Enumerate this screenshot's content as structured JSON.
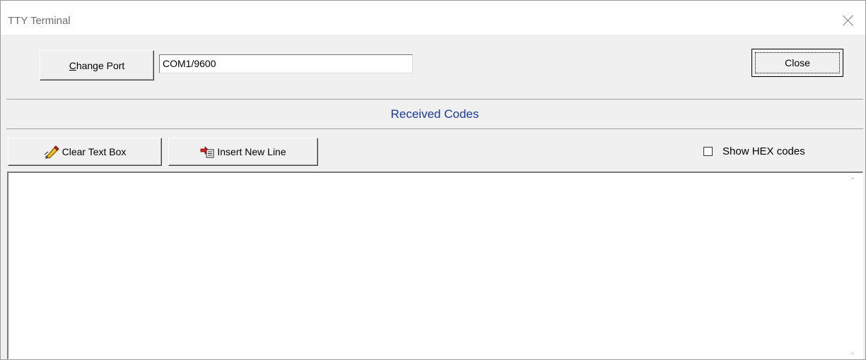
{
  "window": {
    "title": "TTY Terminal"
  },
  "port": {
    "change_port_label_rest": "hange Port",
    "change_port_accel": "C",
    "value": "COM1/9600"
  },
  "close_label": "Close",
  "section_title": "Received Codes",
  "toolbar": {
    "clear_label": "Clear Text Box",
    "insert_label": "Insert New Line"
  },
  "show_hex": {
    "label": "Show HEX codes",
    "checked": false
  },
  "received_text": ""
}
